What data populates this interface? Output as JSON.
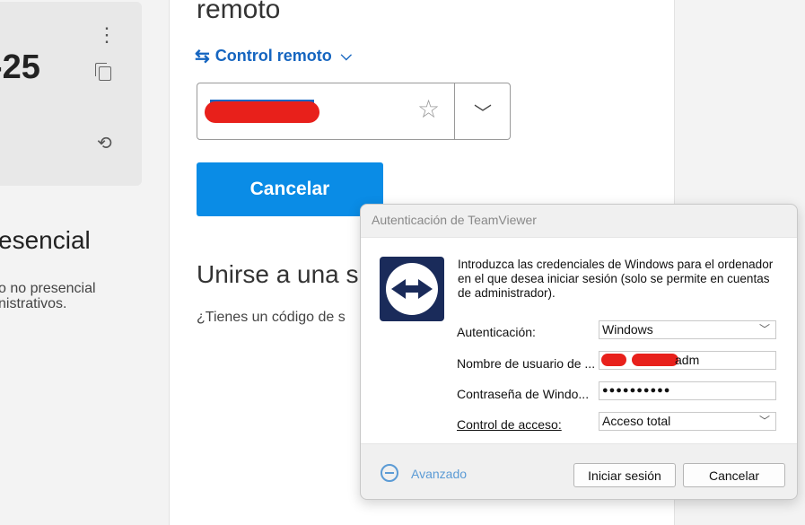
{
  "left": {
    "id_fragment": "-25",
    "heading": "esencial",
    "sub_line1": "o no presencial",
    "sub_line2": "nistrativos."
  },
  "main": {
    "title": "remoto",
    "mode_label": "Control remoto",
    "cancel_label": "Cancelar",
    "join_title": "Unirse a una s",
    "join_sub": "¿Tienes un código de s"
  },
  "dialog": {
    "title": "Autenticación de TeamViewer",
    "description": "Introduzca las credenciales de Windows para el ordenador en el que desea iniciar sesión (solo se permite en cuentas de administrador).",
    "auth_label": "Autenticación:",
    "auth_value": "Windows",
    "user_label": "Nombre de usuario de ...",
    "user_value_suffix": "adm",
    "pass_label": "Contraseña de Windo...",
    "pass_value": "●●●●●●●●●●",
    "access_label": "Control de acceso:",
    "access_value": "Acceso total",
    "advanced_label": "Avanzado",
    "login_label": "Iniciar sesión",
    "cancel_label": "Cancelar"
  },
  "colors": {
    "accent_blue": "#0a8ce6",
    "link_blue": "#1565c0",
    "logo_navy": "#1a2b5a",
    "redaction_red": "#e8201b"
  }
}
